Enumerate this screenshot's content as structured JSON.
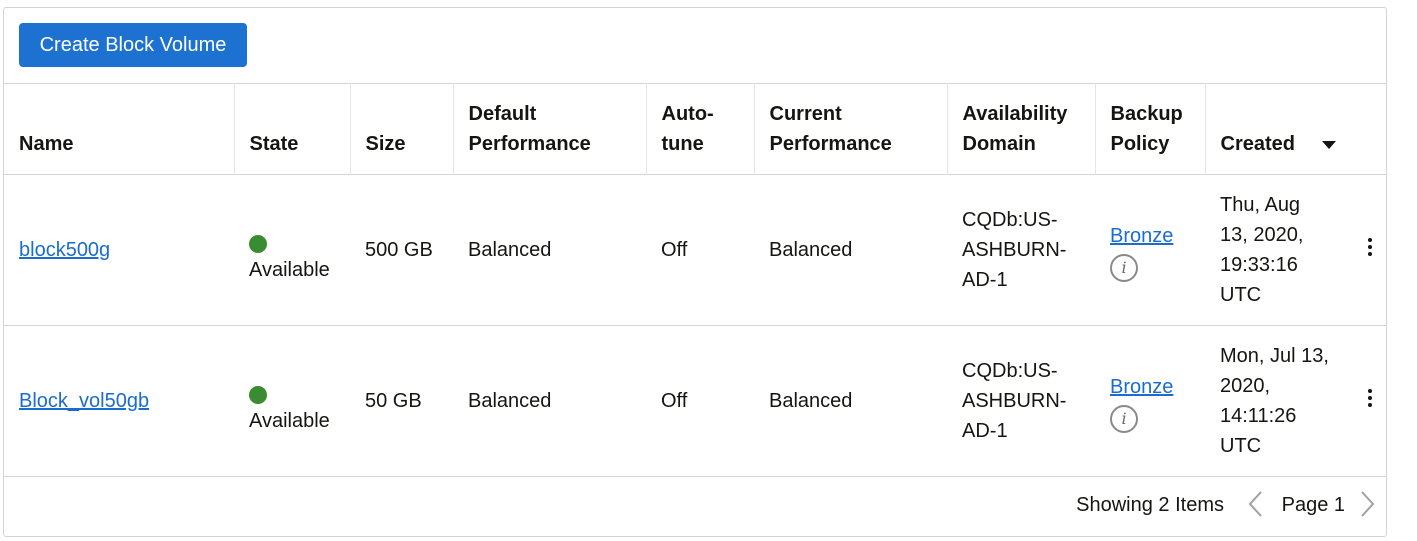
{
  "toolbar": {
    "create_label": "Create Block Volume"
  },
  "columns": {
    "name": "Name",
    "state": "State",
    "size": "Size",
    "default_perf": [
      "Default",
      "Performance"
    ],
    "autotune": [
      "Auto-",
      "tune"
    ],
    "current_perf": [
      "Current",
      "Performance"
    ],
    "ad": [
      "Availability",
      "Domain"
    ],
    "backup": [
      "Backup",
      "Policy"
    ],
    "created": "Created"
  },
  "rows": [
    {
      "name": "block500g",
      "state": "Available",
      "size": "500 GB",
      "default_perf": "Balanced",
      "autotune": "Off",
      "current_perf": "Balanced",
      "ad": [
        "CQDb:US-",
        "ASHBURN-",
        "AD-1"
      ],
      "backup": "Bronze",
      "created": [
        "Thu, Aug",
        "13, 2020,",
        "19:33:16",
        "UTC"
      ]
    },
    {
      "name": "Block_vol50gb",
      "state": "Available",
      "size": "50 GB",
      "default_perf": "Balanced",
      "autotune": "Off",
      "current_perf": "Balanced",
      "ad": [
        "CQDb:US-",
        "ASHBURN-",
        "AD-1"
      ],
      "backup": "Bronze",
      "created": [
        "Mon, Jul 13,",
        "2020,",
        "14:11:26",
        "UTC"
      ]
    }
  ],
  "footer": {
    "showing": "Showing 2 Items",
    "page": "Page 1"
  },
  "icons": {
    "status": "green-dot",
    "info": "info-circle-icon",
    "sort": "caret-down-icon",
    "row_actions": "kebab-menu-icon",
    "prev": "chevron-left-icon",
    "next": "chevron-right-icon"
  },
  "colors": {
    "primary_button": "#1d72d1",
    "link": "#1a6ccf",
    "available": "#3a8c32"
  }
}
